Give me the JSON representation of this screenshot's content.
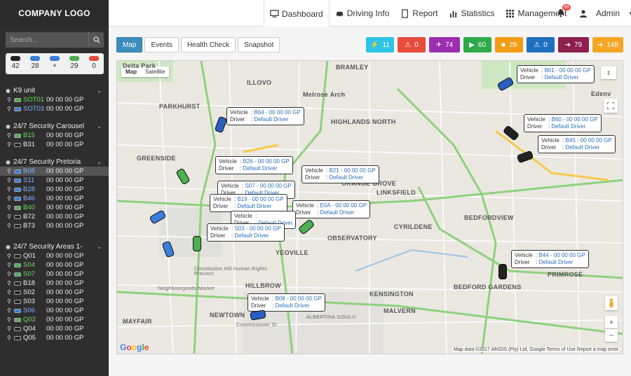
{
  "logo": "COMPANY LOGO",
  "nav": [
    {
      "label": "Dashboard",
      "icon": "monitor-icon"
    },
    {
      "label": "Driving Info",
      "icon": "car-icon"
    },
    {
      "label": "Report",
      "icon": "document-icon"
    },
    {
      "label": "Statistics",
      "icon": "bar-chart-icon"
    },
    {
      "label": "Management",
      "icon": "grid-icon"
    }
  ],
  "notifications": "99",
  "user": "Admin",
  "search": {
    "placeholder": "Search..."
  },
  "counts": [
    {
      "value": "42",
      "color": "#222"
    },
    {
      "value": "28",
      "color": "#3b7ddd"
    },
    {
      "value": "+",
      "color": "#3b7ddd"
    },
    {
      "value": "29",
      "color": "#4caf50"
    },
    {
      "value": "0",
      "color": "#e74c3c"
    }
  ],
  "groups": [
    {
      "name": "K9 unit",
      "rows": [
        {
          "code": "SOT01",
          "color": "#4caf50",
          "gp": "00 00 00 GP"
        },
        {
          "code": "SOT03",
          "color": "#3b7ddd",
          "gp": "00 00 00 GP"
        }
      ]
    },
    {
      "name": "24/7 Security Carousel",
      "rows": [
        {
          "code": "B15",
          "color": "#4caf50",
          "gp": "00 00 00 GP"
        },
        {
          "code": "B31",
          "color": "#222",
          "gp": "00 00 00 GP"
        }
      ]
    },
    {
      "name": "24/7 Security Pretoria",
      "rows": [
        {
          "code": "B08",
          "color": "#3b7ddd",
          "gp": "00 00 00 GP",
          "sel": true
        },
        {
          "code": "S11",
          "color": "#3b7ddd",
          "gp": "00 00 00 GP"
        },
        {
          "code": "B28",
          "color": "#3b7ddd",
          "gp": "00 00 00 GP"
        },
        {
          "code": "B46",
          "color": "#3b7ddd",
          "gp": "00 00 00 GP"
        },
        {
          "code": "B40",
          "color": "#4caf50",
          "gp": "00 00 00 GP"
        },
        {
          "code": "B72",
          "color": "#222",
          "gp": "00 00 00 GP"
        },
        {
          "code": "B73",
          "color": "#222",
          "gp": "00 00 00 GP"
        }
      ]
    },
    {
      "name": "24/7 Security Areas 1-",
      "rows": [
        {
          "code": "Q01",
          "color": "#222",
          "gp": "00 00 00 GP"
        },
        {
          "code": "S04",
          "color": "#4caf50",
          "gp": "00 00 00 GP"
        },
        {
          "code": "S07",
          "color": "#4caf50",
          "gp": "00 00 00 GP"
        },
        {
          "code": "B18",
          "color": "#222",
          "gp": "00 00 00 GP"
        },
        {
          "code": "S02",
          "color": "#222",
          "gp": "00 00 00 GP"
        },
        {
          "code": "S03",
          "color": "#222",
          "gp": "00 00 00 GP"
        },
        {
          "code": "S06",
          "color": "#3b7ddd",
          "gp": "00 00 00 GP"
        },
        {
          "code": "Q02",
          "color": "#4caf50",
          "gp": "00 00 00 GP"
        },
        {
          "code": "Q04",
          "color": "#222",
          "gp": "00 00 00 GP"
        },
        {
          "code": "Q05",
          "color": "#222",
          "gp": "00 00 00 GP"
        }
      ]
    }
  ],
  "tabs": [
    "Map",
    "Events",
    "Health Check",
    "Snapshot"
  ],
  "stats": [
    {
      "value": "11",
      "color": "#2ec4e6",
      "icon": "bolt-icon"
    },
    {
      "value": "0",
      "color": "#e74c3c",
      "icon": "warning-icon"
    },
    {
      "value": "74",
      "color": "#9b2fae",
      "icon": "plane-icon"
    },
    {
      "value": "60",
      "color": "#2eaa4a",
      "icon": "play-icon"
    },
    {
      "value": "29",
      "color": "#f39c12",
      "icon": "stop-icon"
    },
    {
      "value": "0",
      "color": "#1f6fbf",
      "icon": "warning-icon"
    },
    {
      "value": "79",
      "color": "#8e1f4f",
      "icon": "exit-icon"
    },
    {
      "value": "148",
      "color": "#f5a623",
      "icon": "enter-icon"
    }
  ],
  "map": {
    "toggle": [
      "Map",
      "Satellite"
    ],
    "labels": [
      "Delta Park",
      "ILLOVO",
      "Melrose Arch",
      "PARKHURST",
      "HIGHLANDS NORTH",
      "GREENSIDE",
      "BRAMLEY",
      "LINKSFIELD",
      "Edenv",
      "BEDFORDVIEW",
      "ORANGE GROVE",
      "CYRILDENE",
      "OBSERVATORY",
      "YEOVILLE",
      "Constitution Hill Human Rights Precinct",
      "HILLBROW",
      "Neighbourgoods Market",
      "KENSINGTON",
      "BEDFORD GARDENS",
      "PRIMROSE",
      "MAYFAIR",
      "NEWTOWN",
      "MALVERN",
      "Commissioner St",
      "ALBERTINA SISULU"
    ],
    "popups": [
      {
        "vehicle": "B64 - 00 00 00 GP",
        "driver": "Default Driver"
      },
      {
        "vehicle": "B61 - 00 00 00 GP",
        "driver": "Default Driver"
      },
      {
        "vehicle": "B60 - 00 00 00 GP",
        "driver": "Default Driver"
      },
      {
        "vehicle": "B45 - 00 00 00 GP",
        "driver": "Default Driver"
      },
      {
        "vehicle": "B26 - 00 00 00 GP",
        "driver": "Default Driver"
      },
      {
        "vehicle": "B21 - 00 00 00 GP",
        "driver": "Default Driver"
      },
      {
        "vehicle": "S07 - 00 00 00 GP",
        "driver": "Default Driver"
      },
      {
        "vehicle": "B19 - 00 00 00 GP",
        "driver": "Default Driver"
      },
      {
        "vehicle": "E0A - 00 00 00 GP",
        "driver": "Default Driver"
      },
      {
        "vehicle": "",
        "driver": "Default Driver"
      },
      {
        "vehicle": "S03 - 00 00 00 GP",
        "driver": "Default Driver"
      },
      {
        "vehicle": "B44 - 00 00 00 GP",
        "driver": "Default Driver"
      },
      {
        "vehicle": "B08 - 00 00 00 GP",
        "driver": "Default Driver"
      }
    ],
    "popup_keys": {
      "vehicle": "Vehicle",
      "driver": "Driver"
    },
    "google": "Google",
    "attribution": "Map data ©2017 AfriGIS (Pty) Ltd, Google   Terms of Use   Report a map error"
  }
}
